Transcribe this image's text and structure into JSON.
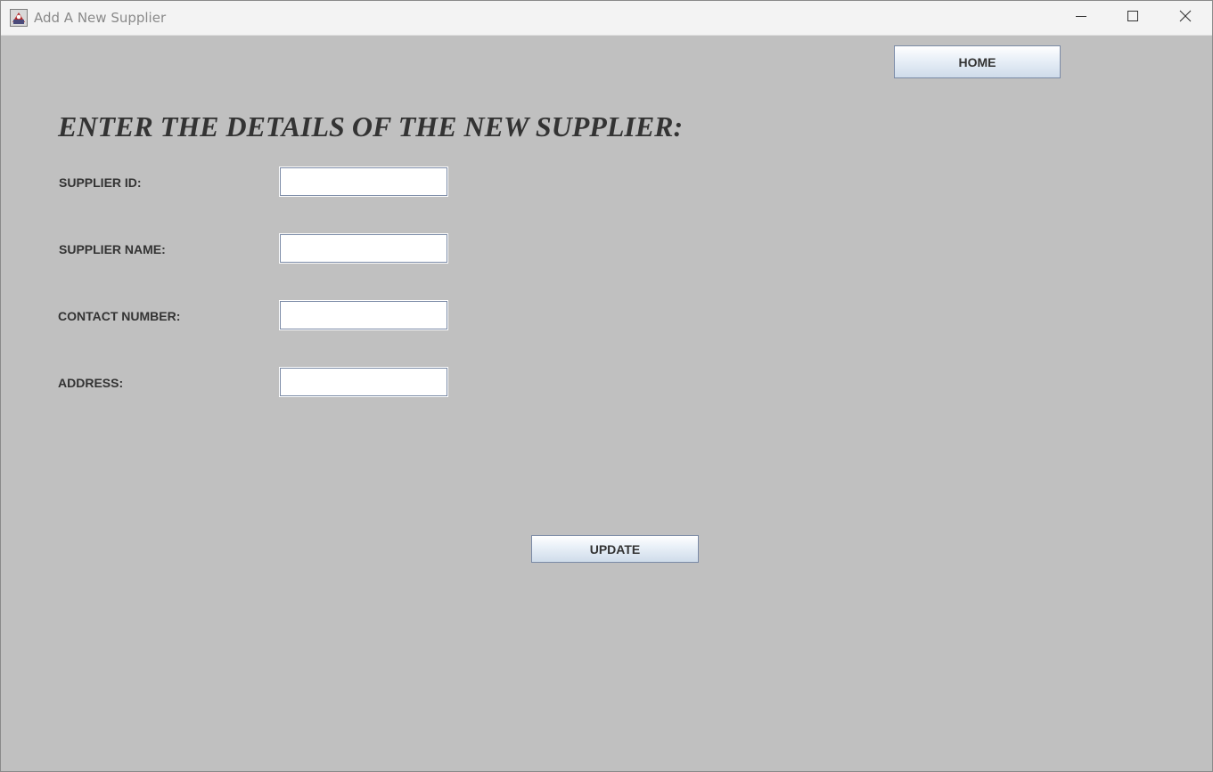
{
  "window": {
    "title": "Add A New Supplier",
    "icon": "java-app-icon",
    "controls": {
      "minimize_icon": "minimize-icon",
      "maximize_icon": "maximize-icon",
      "close_icon": "close-icon"
    }
  },
  "toolbar": {
    "home_label": "HOME"
  },
  "form": {
    "heading": "ENTER THE DETAILS OF THE NEW SUPPLIER:",
    "fields": [
      {
        "label": "SUPPLIER ID:",
        "value": "",
        "placeholder": ""
      },
      {
        "label": "SUPPLIER NAME:",
        "value": "",
        "placeholder": ""
      },
      {
        "label": "CONTACT NUMBER:",
        "value": "",
        "placeholder": ""
      },
      {
        "label": "ADDRESS:",
        "value": "",
        "placeholder": ""
      }
    ],
    "submit_label": "UPDATE"
  },
  "colors": {
    "background": "#c0c0c0",
    "text": "#333333",
    "button_border": "#7a8aa6",
    "titlebar": "#f3f3f3"
  }
}
